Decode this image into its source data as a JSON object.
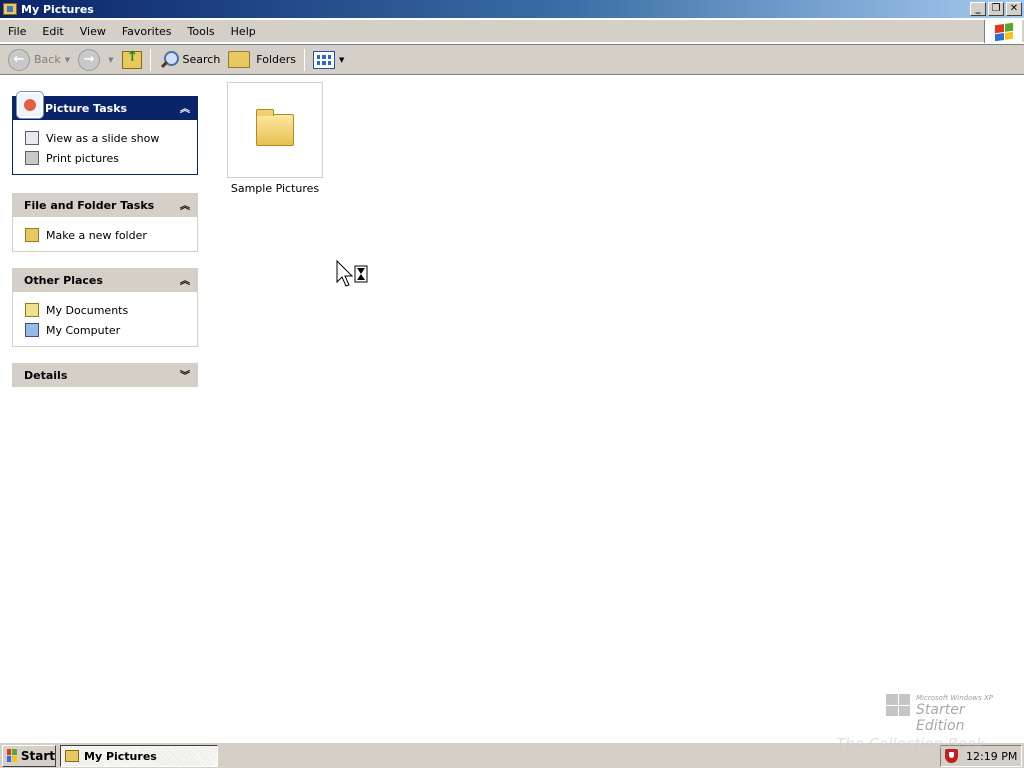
{
  "window": {
    "title": "My Pictures",
    "controls": [
      "minimize",
      "restore",
      "close"
    ]
  },
  "menu": {
    "items": [
      "File",
      "Edit",
      "View",
      "Favorites",
      "Tools",
      "Help"
    ]
  },
  "toolbar": {
    "back_label": "Back",
    "search_label": "Search",
    "folders_label": "Folders"
  },
  "taskpane": {
    "picture_tasks": {
      "title": "Picture Tasks",
      "items": [
        "View as a slide show",
        "Print pictures"
      ]
    },
    "file_folder_tasks": {
      "title": "File and Folder Tasks",
      "items": [
        "Make a new folder"
      ]
    },
    "other_places": {
      "title": "Other Places",
      "items": [
        "My Documents",
        "My Computer"
      ]
    },
    "details": {
      "title": "Details"
    }
  },
  "content": {
    "items": [
      {
        "label": "Sample Pictures",
        "icon": "folder-icon"
      }
    ]
  },
  "edition": {
    "small": "Microsoft Windows XP",
    "big": "Starter Edition"
  },
  "taskbar": {
    "start_label": "Start",
    "task_button_label": "My Pictures",
    "clock": "12:19 PM"
  },
  "watermark": "The Collection Book",
  "colors": {
    "title_bar": "#0a246a",
    "face": "#d4d0c8",
    "special_header": "#0a246a"
  }
}
